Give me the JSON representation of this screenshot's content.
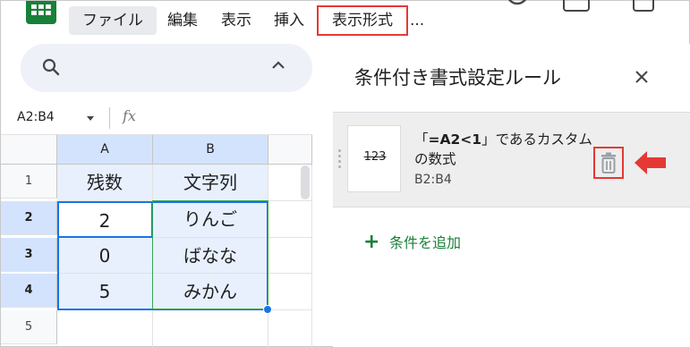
{
  "menu": {
    "file": "ファイル",
    "edit": "編集",
    "view": "表示",
    "insert": "挿入",
    "format": "表示形式",
    "more": "..."
  },
  "formula_bar": {
    "name_box": "A2:B4",
    "fx": "fx"
  },
  "grid": {
    "columns": [
      "A",
      "B"
    ],
    "rows": [
      "1",
      "2",
      "3",
      "4",
      "5"
    ],
    "cells": [
      [
        "残数",
        "文字列"
      ],
      [
        "2",
        "りんご"
      ],
      [
        "0",
        "ばなな"
      ],
      [
        "5",
        "みかん"
      ]
    ]
  },
  "panel": {
    "title": "条件付き書式設定ルール",
    "rule": {
      "preview": "123",
      "desc_prefix": "「",
      "desc_formula": "=A2<1",
      "desc_suffix": "」であるカスタムの数式",
      "range": "B2:B4"
    },
    "add_rule": "条件を追加"
  },
  "colors": {
    "sheets_green": "#188038",
    "selection_blue": "#1a73e8",
    "highlight_red": "#e53935"
  }
}
